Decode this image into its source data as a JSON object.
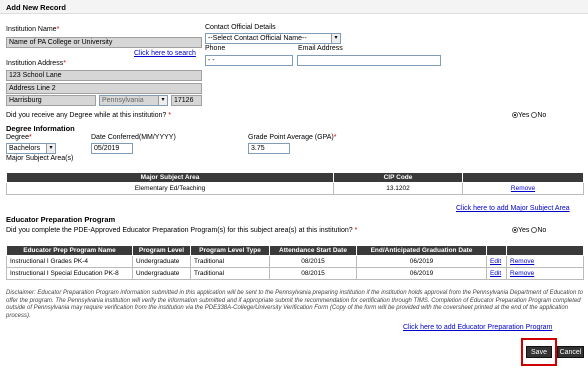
{
  "header": {
    "title": "Add New Record"
  },
  "institution": {
    "name_label": "Institution Name",
    "name_value": "Name of PA College or University",
    "search_link": "Click here to search",
    "address_label": "Institution Address",
    "address1": "123 School Lane",
    "address2": "Address Line 2",
    "city": "Harrisburg",
    "state": "Pennsylvania",
    "zip": "17126"
  },
  "contact": {
    "label": "Contact Official Details",
    "select_value": "--Select Contact Official Name--",
    "phone_label": "Phone",
    "phone_value": "  -  -",
    "email_label": "Email Address",
    "email_value": ""
  },
  "degree_question": {
    "text": "Did you receive any Degree while at this institution?",
    "asterisk": "*",
    "yes": "Yes",
    "no": "No"
  },
  "degree_info": {
    "title": "Degree Information",
    "degree_label": "Degree",
    "degree_value": "Bachelors",
    "date_label": "Date Conferred(MM/YYYY)",
    "date_value": "05/2019",
    "gpa_label": "Grade Point Average (GPA)",
    "gpa_value": "3.75",
    "major_label": "Major Subject Area(s)"
  },
  "major_table": {
    "headers": [
      "Major Subject Area",
      "CIP Code",
      ""
    ],
    "rows": [
      {
        "area": "Elementary Ed/Teaching",
        "cip": "13.1202",
        "action": "Remove"
      }
    ],
    "add_link": "Click here to add Major Subject Area"
  },
  "edu_prep": {
    "title": "Educator Preparation Program",
    "question": "Did you complete the PDE-Approved Educator Preparation Program(s) for this subject area(s) at this institution?",
    "asterisk": "*",
    "yes": "Yes",
    "no": "No",
    "headers": [
      "Educator Prep Program Name",
      "Program Level",
      "Program Level Type",
      "Attendance Start Date",
      "End/Anticipated Graduation Date",
      "",
      ""
    ],
    "rows": [
      {
        "name": "Instructional I Grades PK-4",
        "level": "Undergraduate",
        "type": "Traditional",
        "start": "08/2015",
        "end": "06/2019",
        "edit": "Edit",
        "remove": "Remove"
      },
      {
        "name": "Instructional I Special Education PK-8",
        "level": "Undergraduate",
        "type": "Traditional",
        "start": "08/2015",
        "end": "06/2019",
        "edit": "Edit",
        "remove": "Remove"
      }
    ],
    "disclaimer": "Disclaimer: Educator Preparation Program information submitted in this application will be sent to the Pennsylvania preparing institution if the institution holds approval from the Pennsylvania Department of Education to offer the program. The Pennsylvania institution will verify the information submitted and if appropriate submit the recommendation for certification through TIMS. Completion of Educator Preparation Program completed outside of Pennsylvania may require verification from the institution via the PDE338A-College/University Verification Form (Copy of the form will be provided with the coversheet printed at the end of the application process).",
    "add_link": "Click here to add Educator Preparation Program"
  },
  "actions": {
    "save": "Save",
    "cancel": "Cancel"
  },
  "colors": {
    "highlight": "#cc0000",
    "header_bg": "#3a3a3a",
    "link": "#0000cc"
  }
}
